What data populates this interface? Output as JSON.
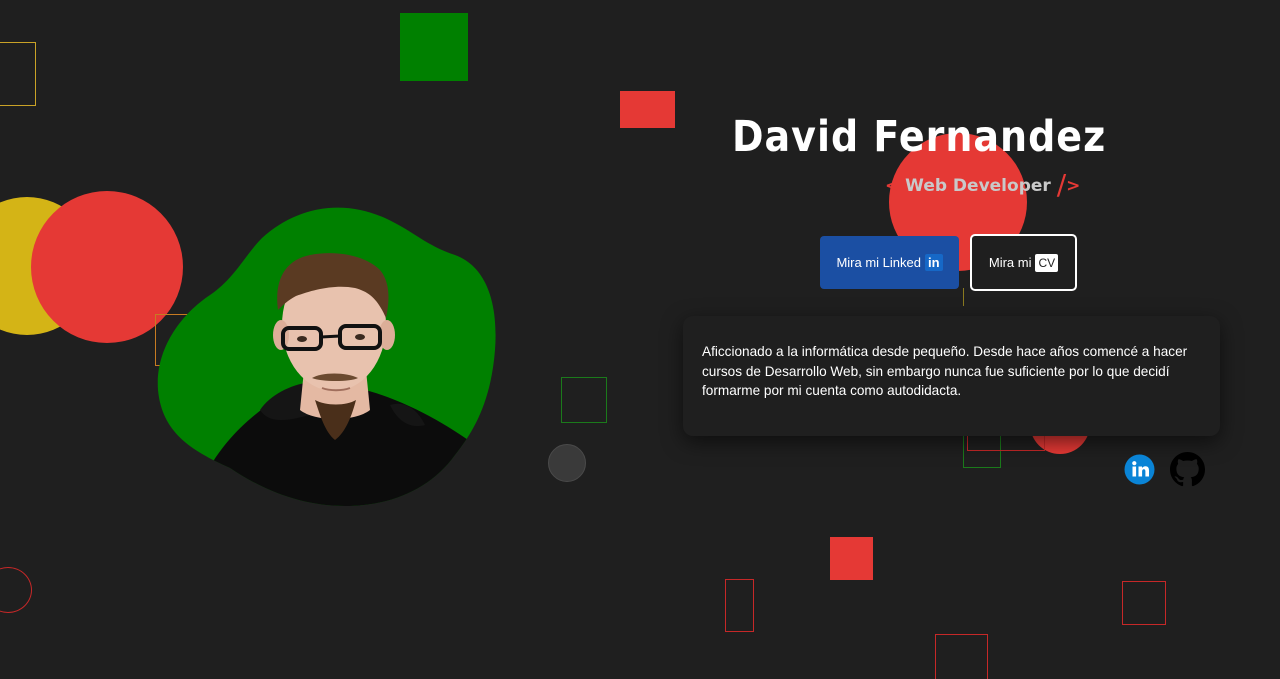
{
  "profile": {
    "name": "David Fernandez",
    "role_open": "<",
    "role": "Web Developer",
    "role_close_slash": "/",
    "role_close_bracket": ">"
  },
  "buttons": {
    "linkedin_label": "Mira mi Linked",
    "linkedin_badge": "in",
    "cv_label": "Mira mi",
    "cv_badge": "CV"
  },
  "about": {
    "text": "Aficcionado a la informática desde pequeño. Desde hace años comencé a hacer cursos de Desarrollo Web, sin embargo nunca fue suficiente por lo que decidí formarme por mi cuenta como autodidacta."
  },
  "social": {
    "linkedin_icon": "linkedin-icon",
    "github_icon": "github-icon"
  },
  "colors": {
    "background": "#1f1f1f",
    "accent_red": "#e53935",
    "accent_green": "#008000",
    "accent_yellow": "#d4b416",
    "linkedin_blue": "#1b4fa3"
  }
}
